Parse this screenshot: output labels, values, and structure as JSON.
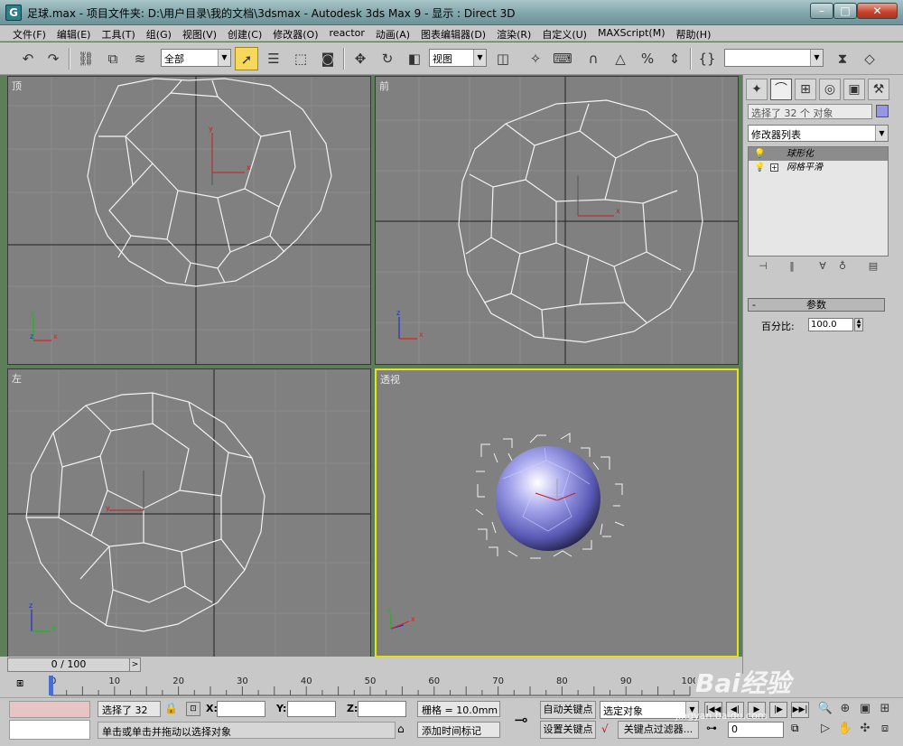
{
  "window": {
    "title": "足球.max     - 项目文件夹: D:\\用户目录\\我的文档\\3dsmax     - Autodesk 3ds Max 9     - 显示 : Direct 3D",
    "app_icon": "3ds-max-icon",
    "minimize": "–",
    "maximize": "□",
    "close": "✕"
  },
  "menu": [
    "文件(F)",
    "编辑(E)",
    "工具(T)",
    "组(G)",
    "视图(V)",
    "创建(C)",
    "修改器(O)",
    "reactor",
    "动画(A)",
    "图表编辑器(D)",
    "渲染(R)",
    "自定义(U)",
    "MAXScript(M)",
    "帮助(H)"
  ],
  "toolbar": {
    "selection_filter": "全部",
    "ref_coord": "视图",
    "named_selection": ""
  },
  "viewports": {
    "top": {
      "label": "顶"
    },
    "front": {
      "label": "前"
    },
    "left": {
      "label": "左"
    },
    "perspective": {
      "label": "透视"
    }
  },
  "command_panel": {
    "tabs": [
      "create-icon",
      "modify-icon",
      "hierarchy-icon",
      "motion-icon",
      "display-icon",
      "utilities-icon"
    ],
    "selection_text": "选择了 32 个 对象",
    "selection_color": "#9696e6",
    "modifier_list": "修改器列表",
    "stack": [
      {
        "label": "球形化",
        "selected": true,
        "expandable": false
      },
      {
        "label": "网格平滑",
        "selected": false,
        "expandable": true
      }
    ],
    "rollout_title": "参数",
    "rollout_toggle": "-",
    "percent_label": "百分比:",
    "percent_value": "100.0"
  },
  "time": {
    "frame_display": "0 / 100",
    "current_frame": 0,
    "total_frames": 100,
    "ticks": [
      "0",
      "10",
      "20",
      "30",
      "40",
      "50",
      "60",
      "70",
      "80",
      "90",
      "100"
    ]
  },
  "status": {
    "selection": "选择了 32",
    "x_label": "X:",
    "y_label": "Y:",
    "z_label": "Z:",
    "grid": "栅格 = 10.0mm",
    "auto_key": "自动关键点",
    "set_key": "设置关键点",
    "key_mode": "选定对象",
    "key_filters": "关键点过滤器...",
    "prompt": "单击或单击并拖动以选择对象",
    "add_time_tag": "添加时间标记",
    "frame_field": "0"
  },
  "watermark": {
    "text": "Bai经验",
    "url": "jingyan.baidu.com"
  }
}
